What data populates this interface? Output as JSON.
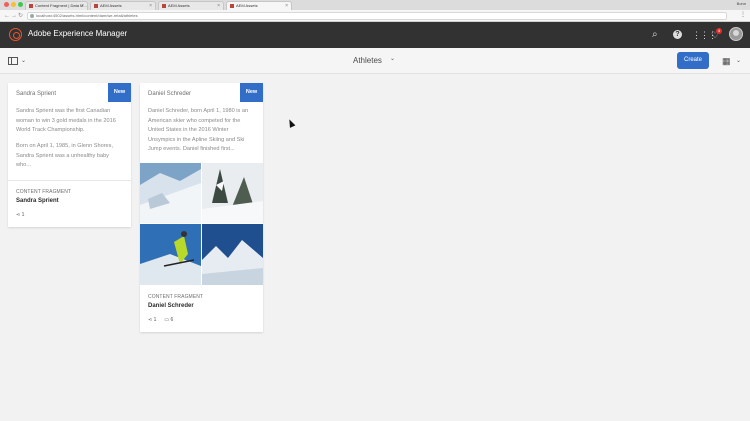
{
  "browser": {
    "tabs": [
      {
        "label": "Content Fragment | Data M…"
      },
      {
        "label": "AEM Assets"
      },
      {
        "label": "AEM Assets"
      },
      {
        "label": "AEM Assets"
      }
    ],
    "user_name": "Bonn",
    "url": "localhost:4502/assets.html/content/dam/we-retail/athletes"
  },
  "header": {
    "product": "Adobe Experience Manager",
    "notification_count": "4"
  },
  "actionbar": {
    "title": "Athletes",
    "create_label": "Create"
  },
  "cards": [
    {
      "name": "Sandra Sprient",
      "badge": "New",
      "description": [
        "Sandra Sprient was the first Canadian woman to win 3 gold medals in the 2016 World Track Championship.",
        "Born on April 1, 1985, in Glenn Shores, Sandra Sprient was a unhealthy baby who..."
      ],
      "type": "CONTENT FRAGMENT",
      "title": "Sandra Sprient",
      "shares": "1"
    },
    {
      "name": "Daniel Schreder",
      "badge": "New",
      "description": [
        "Daniel Schreder, born April 1, 1980 is an American skier who competed for the United States in the 2016 Winter Unsympics in the Apline Skiing and Ski Jump events. Daniel finished first..."
      ],
      "type": "CONTENT FRAGMENT",
      "title": "Daniel Schreder",
      "shares": "1",
      "assets": "6"
    }
  ],
  "colors": {
    "accent": "#326ec8",
    "header_bg": "#323232",
    "page_bg": "#f2f2f2",
    "logo": "#e8552c"
  }
}
